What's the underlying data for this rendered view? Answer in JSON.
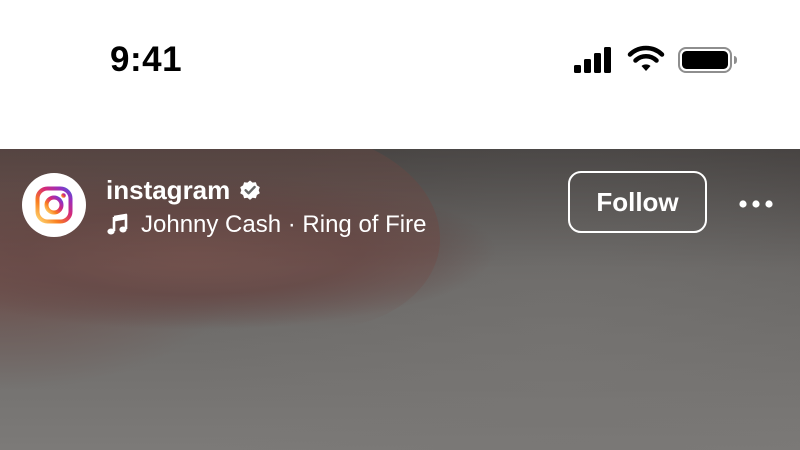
{
  "status_bar": {
    "time": "9:41",
    "icons": [
      "cellular-signal-icon",
      "wifi-icon",
      "battery-icon"
    ]
  },
  "post_header": {
    "account": {
      "username": "instagram",
      "verified": true,
      "avatar_icon": "instagram-logo-icon"
    },
    "audio": {
      "icon": "music-note-icon",
      "label": "Johnny Cash · Ring of Fire"
    },
    "follow_label": "Follow",
    "more_icon": "more-options-icon"
  },
  "colors": {
    "overlay_text": "#ffffff",
    "status_text": "#000000",
    "logo_gradient": [
      "#feda75",
      "#fa7e1e",
      "#d62976",
      "#962fbf",
      "#4f5bd5"
    ]
  }
}
